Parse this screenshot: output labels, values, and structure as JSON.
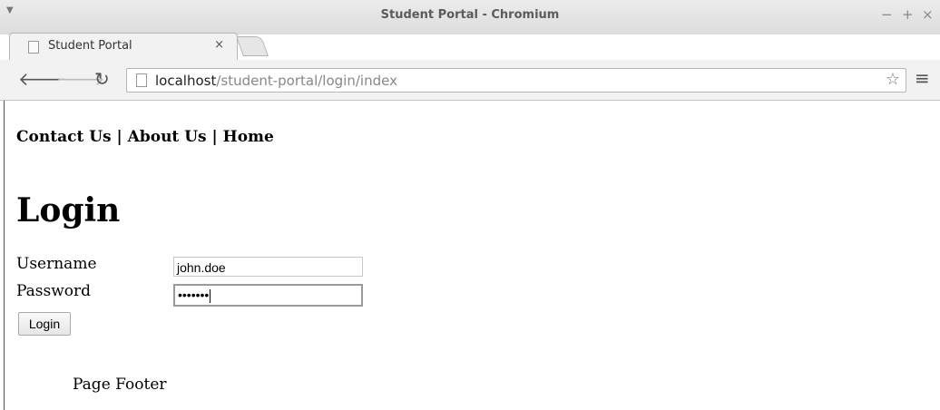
{
  "window": {
    "title": "Student Portal - Chromium",
    "controls": {
      "minimize": "−",
      "maximize": "+",
      "close": "×"
    }
  },
  "tab": {
    "title": "Student Portal",
    "close": "×"
  },
  "toolbar": {
    "url_host": "localhost",
    "url_path": "/student-portal/login/index",
    "icons": [
      "back-arrow-icon",
      "forward-arrow-icon",
      "reload-icon",
      "page-icon",
      "star-icon",
      "menu-icon"
    ]
  },
  "page": {
    "nav": {
      "contact": "Contact Us",
      "sep1": " | ",
      "about": "About Us",
      "sep2": " | ",
      "home": "Home"
    },
    "heading": "Login",
    "form": {
      "username_label": "Username",
      "username_value": "john.doe",
      "password_label": "Password",
      "password_masked": "•••••••",
      "submit_label": "Login"
    },
    "footer": "Page Footer"
  }
}
